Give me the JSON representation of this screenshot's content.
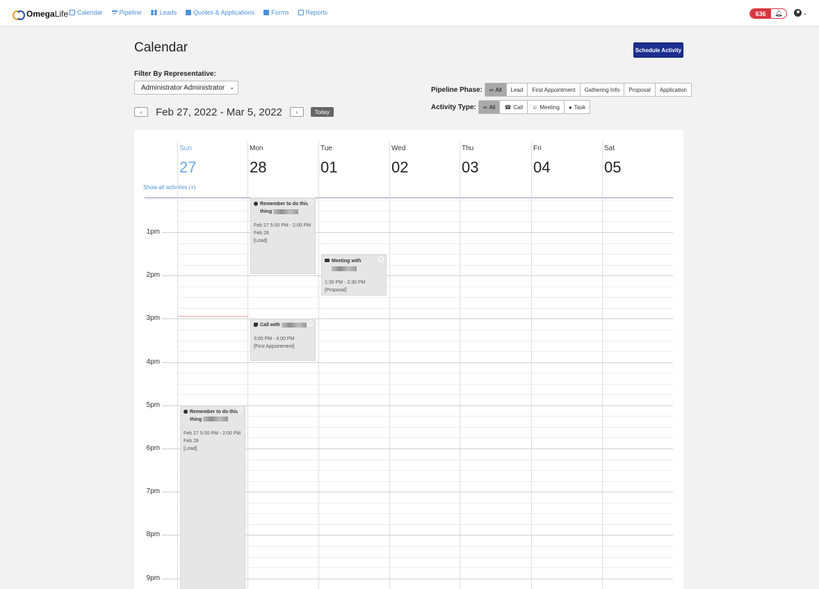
{
  "app": {
    "brand_bold": "Omega",
    "brand_rest": "Life"
  },
  "nav": {
    "calendar": "Calendar",
    "pipeline": "Pipeline",
    "leads": "Leads",
    "quotes": "Quotes & Applications",
    "forms": "Forms",
    "reports": "Reports"
  },
  "notifications": {
    "count": "636"
  },
  "page": {
    "title": "Calendar",
    "schedule_button": "Schedule Activity",
    "filter_label": "Filter By Representative:",
    "representative": "Administrator Administrator",
    "date_range": "Feb 27, 2022 - Mar 5, 2022",
    "prev_label": "‹",
    "next_label": "›",
    "today_label": "Today"
  },
  "pipeline_phase": {
    "label": "Pipeline Phase:",
    "options": [
      "All",
      "Lead",
      "First Appointment",
      "Gathering Info",
      "Proposal",
      "Application"
    ],
    "selected": "All"
  },
  "activity_type": {
    "label": "Activity Type:",
    "options": [
      "All",
      "Call",
      "Meeting",
      "Task"
    ],
    "selected": "All"
  },
  "calendar": {
    "show_all": "Show all activities (+)",
    "days": [
      {
        "name": "Sun",
        "num": "27",
        "today": true
      },
      {
        "name": "Mon",
        "num": "28"
      },
      {
        "name": "Tue",
        "num": "01"
      },
      {
        "name": "Wed",
        "num": "02"
      },
      {
        "name": "Thu",
        "num": "03"
      },
      {
        "name": "Fri",
        "num": "04"
      },
      {
        "name": "Sat",
        "num": "05"
      }
    ],
    "hours": [
      "1pm",
      "2pm",
      "3pm",
      "4pm",
      "5pm",
      "6pm",
      "7pm",
      "8pm",
      "9pm"
    ],
    "events": [
      {
        "day": 1,
        "type": "task-icon",
        "title": "Remember to do this thing",
        "time": "Feb 27 5:00 PM - 2:00 PM Feb 28",
        "phase": "[Lead]"
      },
      {
        "day": 2,
        "type": "people-icon",
        "title": "Meeting with",
        "time": "1:30 PM - 2:30 PM",
        "phase": "[Proposal]"
      },
      {
        "day": 1,
        "type": "phone-icon",
        "title": "Call with",
        "time": "3:00 PM - 4:00 PM",
        "phase": "[First Appointment]"
      },
      {
        "day": 0,
        "type": "task-icon",
        "title": "Remember to do this thing",
        "time": "Feb 27 5:00 PM - 2:00 PM Feb 28",
        "phase": "[Lead]"
      }
    ]
  },
  "colors": {
    "primary": "#1a2f8f",
    "link": "#4a90d9",
    "badge": "#d9363e",
    "today": "#6fa8e8"
  }
}
